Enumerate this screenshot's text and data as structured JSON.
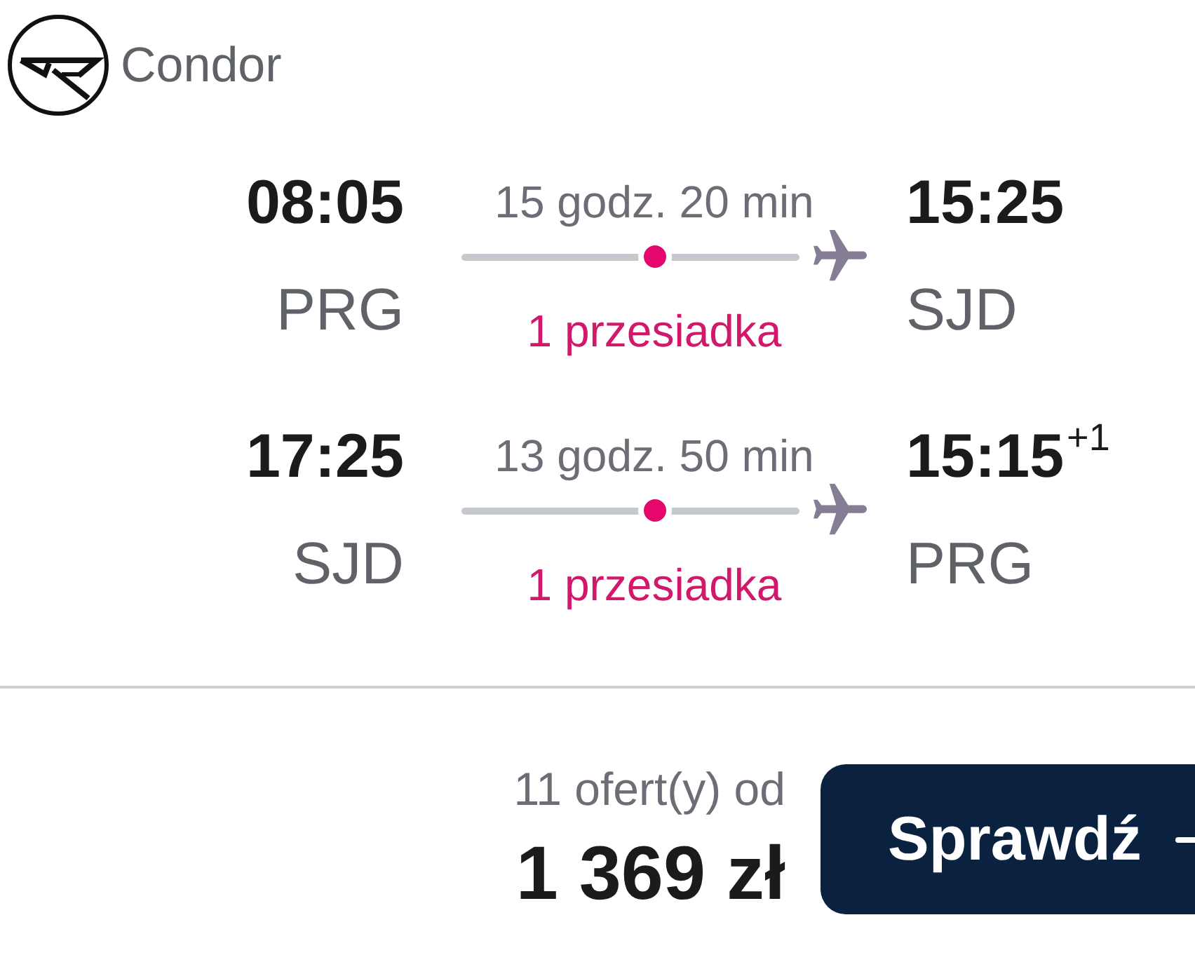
{
  "airline": {
    "name": "Condor"
  },
  "legs": [
    {
      "departure": {
        "time": "08:05",
        "airport": "PRG"
      },
      "duration": "15 godz. 20 min",
      "stops": "1 przesiadka",
      "arrival": {
        "time": "15:25",
        "airport": "SJD"
      }
    },
    {
      "departure": {
        "time": "17:25",
        "airport": "SJD"
      },
      "duration": "13 godz. 50 min",
      "stops": "1 przesiadka",
      "arrival": {
        "time": "15:15",
        "day_offset": "+1",
        "airport": "PRG"
      }
    }
  ],
  "offer": {
    "count_text": "11 ofert(y) od",
    "price": "1 369 zł",
    "button": "Sprawdź"
  }
}
